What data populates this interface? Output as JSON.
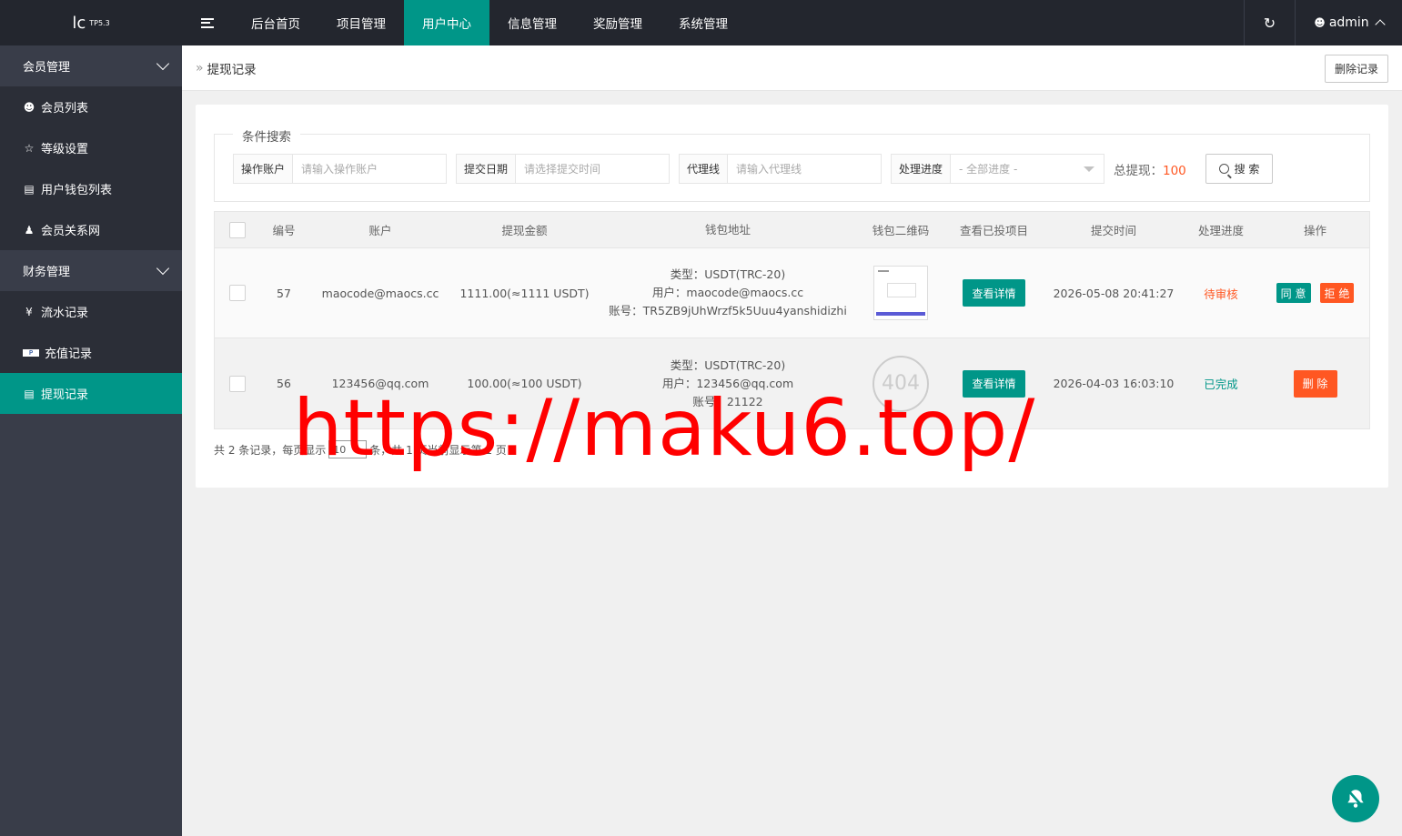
{
  "logo": {
    "text": "lc",
    "version": "TP5.3"
  },
  "sidebar": {
    "groups": [
      {
        "label": "会员管理",
        "items": [
          {
            "label": "会员列表",
            "icon": "user-icon"
          },
          {
            "label": "等级设置",
            "icon": "star-icon"
          },
          {
            "label": "用户钱包列表",
            "icon": "card-icon"
          },
          {
            "label": "会员关系网",
            "icon": "users-icon"
          }
        ]
      },
      {
        "label": "财务管理",
        "items": [
          {
            "label": "流水记录",
            "icon": "yen-icon"
          },
          {
            "label": "充值记录",
            "icon": "paypal-icon"
          },
          {
            "label": "提现记录",
            "icon": "card-icon",
            "active": true
          }
        ]
      }
    ]
  },
  "topnav": {
    "tabs": [
      "后台首页",
      "项目管理",
      "用户中心",
      "信息管理",
      "奖励管理",
      "系统管理"
    ],
    "active_tab": "用户中心",
    "user": "admin"
  },
  "breadcrumb": {
    "title": "提现记录",
    "delete_button": "删除记录"
  },
  "search": {
    "legend": "条件搜索",
    "account_label": "操作账户",
    "account_placeholder": "请输入操作账户",
    "date_label": "提交日期",
    "date_placeholder": "请选择提交时间",
    "agent_label": "代理线",
    "agent_placeholder": "请输入代理线",
    "progress_label": "处理进度",
    "progress_selected": "- 全部进度 -",
    "total_label": "总提现：",
    "total_value": "100",
    "button": "搜 索"
  },
  "table": {
    "headers": [
      "编号",
      "账户",
      "提现金额",
      "钱包地址",
      "钱包二维码",
      "查看已投项目",
      "提交时间",
      "处理进度",
      "操作"
    ],
    "rows": [
      {
        "id": "57",
        "account": "maocode@maocs.cc",
        "amount": "1111.00(≈1111 USDT)",
        "wallet_type": "类型：USDT(TRC-20)",
        "wallet_user": "用户：maocode@maocs.cc",
        "wallet_no": "账号：TR5ZB9jUhWrzf5k5Uuu4yanshidizhi",
        "detail": "查看详情",
        "time": "2026-05-08 20:41:27",
        "status": "待审核",
        "approve": "同 意",
        "reject": "拒 绝"
      },
      {
        "id": "56",
        "account": "123456@qq.com",
        "amount": "100.00(≈100 USDT)",
        "wallet_type": "类型：USDT(TRC-20)",
        "wallet_user": "用户：123456@qq.com",
        "wallet_no": "账号：21122",
        "qr_text": "404",
        "detail": "查看详情",
        "time": "2026-04-03 16:03:10",
        "status": "已完成",
        "delete": "删 除"
      }
    ]
  },
  "pager": {
    "prefix": "共 2 条记录，每页显示",
    "per_page": "10",
    "suffix": "条，共 1 页当前显示第 1 页"
  },
  "watermark": "https://maku6.top/",
  "colors": {
    "accent": "#009688",
    "danger": "#ff5722",
    "sidebar": "#393d49",
    "topbar": "#23262e"
  }
}
